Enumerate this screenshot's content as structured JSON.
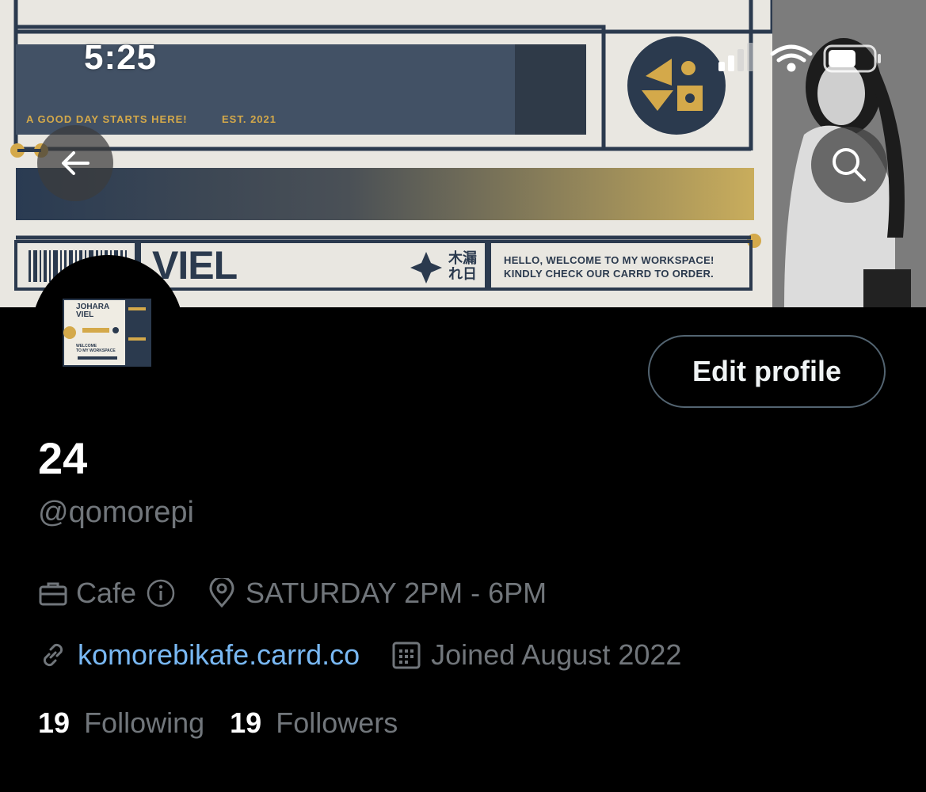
{
  "status_bar": {
    "time": "5:25"
  },
  "banner": {
    "tagline": "A GOOD DAY STARTS HERE!",
    "est": "EST. 2021",
    "brand_word": "VIEL",
    "kanji_top": "木漏",
    "kanji_bottom": "れ日",
    "welcome_line1": "HELLO, WELCOME TO MY WORKSPACE!",
    "welcome_line2": "KINDLY CHECK OUR CARRD TO ORDER."
  },
  "avatar_card": {
    "title_line1": "JOHARA",
    "title_line2": "VIEL",
    "welcome": "WELCOME",
    "workspace": "TO MY WORKSPACE"
  },
  "profile": {
    "edit_label": "Edit profile",
    "display_name": "24",
    "handle": "@qomorepi",
    "category": "Cafe",
    "location": "SATURDAY 2PM - 6PM",
    "website": "komorebikafe.carrd.co",
    "joined": "Joined August 2022",
    "following_count": "19",
    "following_label": "Following",
    "followers_count": "19",
    "followers_label": "Followers"
  },
  "colors": {
    "accent_link": "#79b8f3",
    "muted": "#71767b",
    "banner_navy": "#2b3a4e",
    "banner_gold": "#d4a94a"
  },
  "icons": [
    "back-arrow-icon",
    "search-icon",
    "briefcase-icon",
    "info-icon",
    "location-pin-icon",
    "link-icon",
    "calendar-icon",
    "signal-icon",
    "wifi-icon",
    "battery-icon"
  ]
}
